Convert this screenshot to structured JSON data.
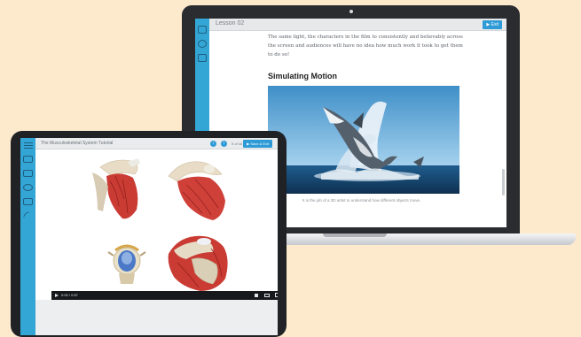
{
  "laptop": {
    "window_title": "Lesson 02",
    "exit_label": "Exit",
    "paragraph_lines": [
      "The same light, the characters in the film to consistently and believably across",
      "the screen and audiences will have no idea how much work it took to get them",
      "to do so!"
    ],
    "section_heading": "Simulating Motion",
    "image_caption": "It is the job of a 3D artist to understand how different objects move.",
    "sidebar_icons": [
      "notes-icon",
      "audio-icon",
      "folder-icon"
    ]
  },
  "tablet": {
    "window_title": "The Musculoskeletal System Tutorial",
    "prev_label": "‹",
    "next_label": "›",
    "page_indicator": "5 of 16",
    "save_label": "Save & Exit",
    "video_time": "0:00 / 0:57",
    "sidebar_icons": [
      "menu-icon",
      "folder-icon",
      "notes-icon",
      "audio-icon",
      "media-icon",
      "link-icon"
    ]
  },
  "colors": {
    "accent_blue": "#2f9bd6",
    "sidebar_blue": "#34a6d5",
    "background": "#fde9cc",
    "device_frame": "#2a2c30"
  }
}
